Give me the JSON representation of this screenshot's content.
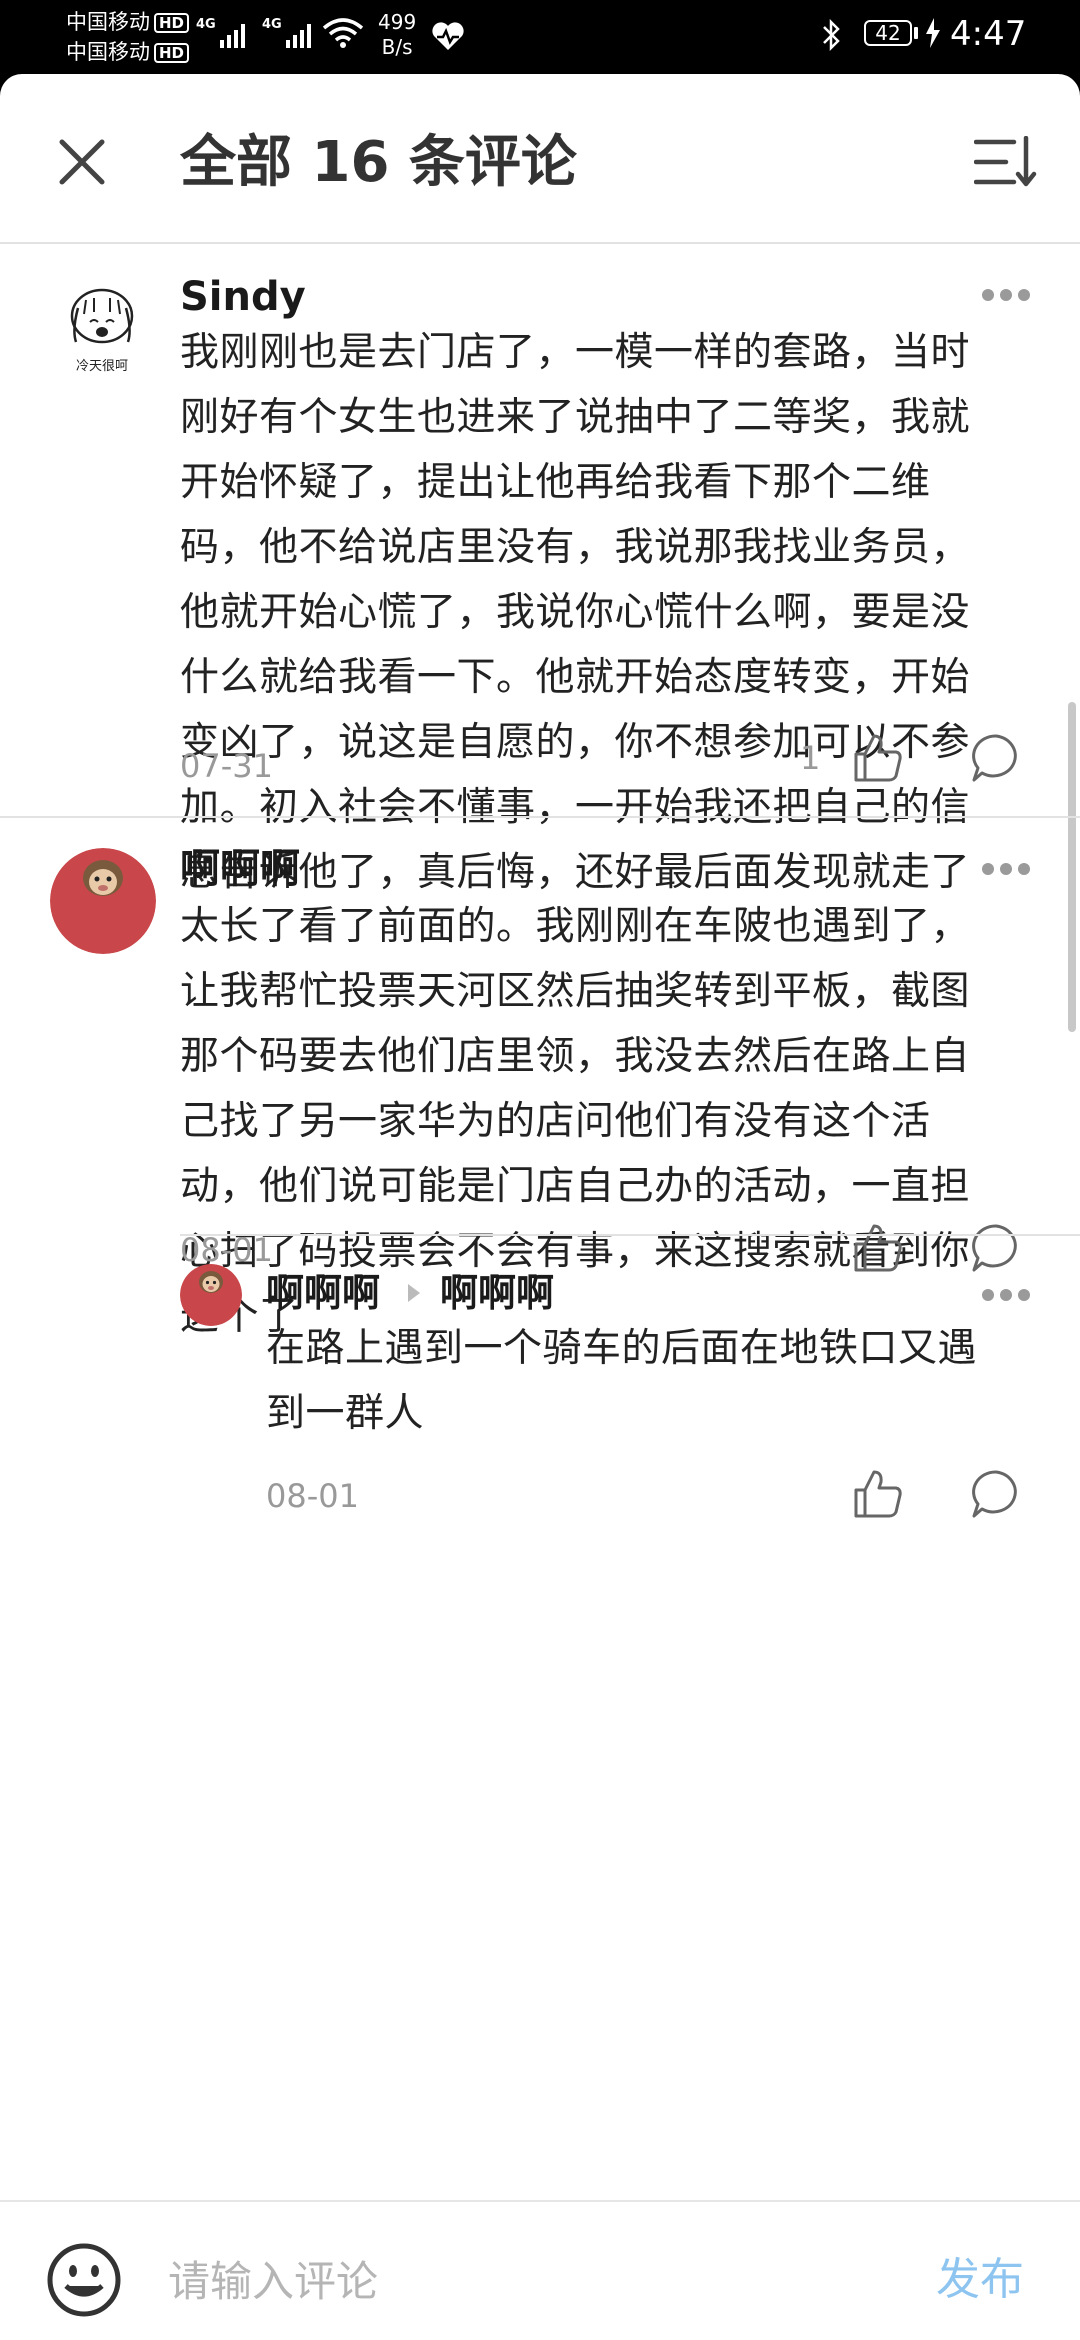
{
  "status_bar": {
    "carrier_1": "中国移动",
    "carrier_2": "中国移动",
    "hd_badge": "HD",
    "network_1": "4G",
    "network_2": "4G",
    "net_speed_value": "499",
    "net_speed_unit": "B/s",
    "battery": "42",
    "time": "4:47"
  },
  "header": {
    "title": "全部 16 条评论",
    "close_icon": "close-icon",
    "sort_icon": "sort-icon"
  },
  "comments": [
    {
      "author": "Sindy",
      "avatar_caption": "冷天很呵",
      "lines": [
        "我刚刚也是去门店了，一模一样的套路，当时",
        "刚好有个女生也进来了说抽中了二等奖，我就",
        "开始怀疑了，提出让他再给我看下那个二维",
        "码，他不给说店里没有，我说那我找业务员，",
        "他就开始心慌了，我说你心慌什么啊，要是没",
        "什么就给我看一下。他就开始态度转变，开始",
        "变凶了，说这是自愿的，你不想参加可以不参",
        "加。初入社会不懂事，一开始我还把自己的信",
        "息告诉他了，真后悔，还好最后面发现就走了"
      ],
      "date": "07-31",
      "likes": "1"
    },
    {
      "author": "啊啊啊",
      "lines": [
        "太长了看了前面的。我刚刚在车陂也遇到了，",
        "让我帮忙投票天河区然后抽奖转到平板，截图",
        "那个码要去他们店里领，我没去然后在路上自",
        "己找了另一家华为的店问他们有没有这个活",
        "动，他们说可能是门店自己办的活动，一直担",
        "心扫了码投票会不会有事，来这搜索就看到你",
        "这个了"
      ],
      "date": "08-01"
    }
  ],
  "reply": {
    "author": "啊啊啊",
    "reply_to": "啊啊啊",
    "lines": [
      "在路上遇到一个骑车的后面在地铁口又遇",
      "到一群人"
    ],
    "date": "08-01"
  },
  "input_bar": {
    "placeholder": "请输入评论",
    "send_label": "发布",
    "send_color": "#8ec5f0"
  },
  "colors": {
    "accent": "#8ec5f0",
    "avatar_red": "#c9474a"
  }
}
